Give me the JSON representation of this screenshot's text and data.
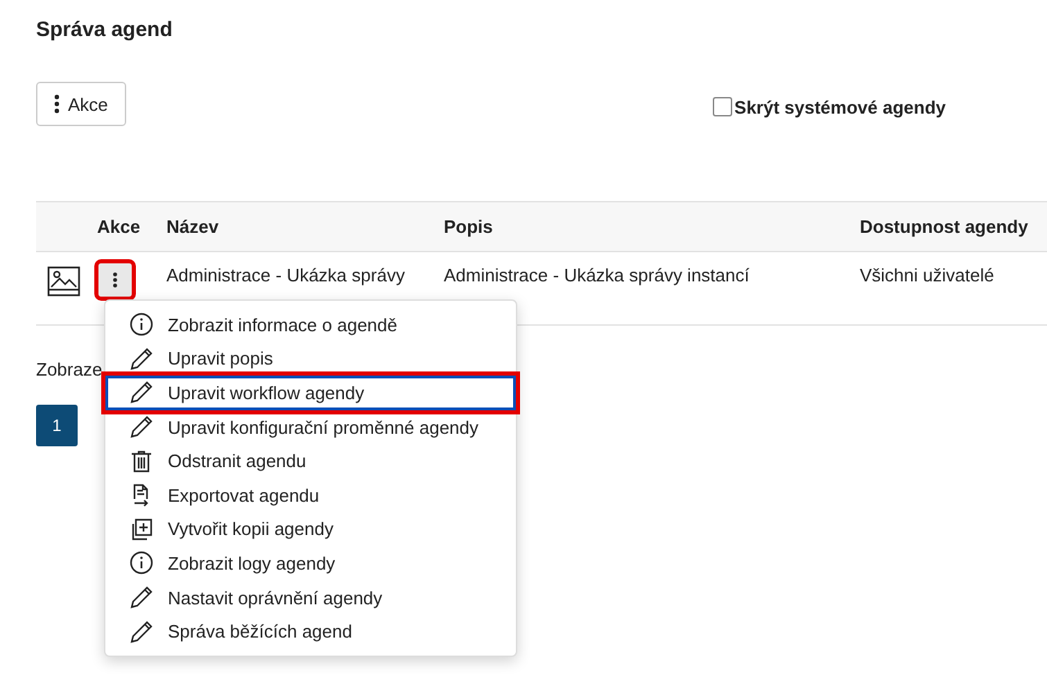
{
  "page": {
    "title": "Správa agend"
  },
  "toolbar": {
    "actions_button": "Akce",
    "hide_system": {
      "label": "Skrýt systémové agendy",
      "checked": false
    }
  },
  "table": {
    "columns": [
      "",
      "Akce",
      "Název",
      "Popis",
      "Dostupnost agendy"
    ],
    "rows": [
      {
        "name": "Administrace - Ukázka správy",
        "description": "Administrace - Ukázka správy instancí",
        "availability": "Všichni uživatelé",
        "actions_highlighted": true
      }
    ]
  },
  "footer_text": "Zobraze",
  "pagination": [
    {
      "label": "1",
      "selected": true
    }
  ],
  "context_menu": {
    "items": [
      {
        "kind": "info",
        "label": "Zobrazit informace o agendě",
        "highlighted": false
      },
      {
        "kind": "edit",
        "label": "Upravit popis",
        "highlighted": false
      },
      {
        "kind": "edit",
        "label": "Upravit workflow agendy",
        "highlighted": true
      },
      {
        "kind": "edit",
        "label": "Upravit konfigurační proměnné agendy",
        "highlighted": false
      },
      {
        "kind": "delete",
        "label": "Odstranit agendu",
        "highlighted": false
      },
      {
        "kind": "export",
        "label": "Exportovat agendu",
        "highlighted": false
      },
      {
        "kind": "copy",
        "label": "Vytvořit kopii agendy",
        "highlighted": false
      },
      {
        "kind": "info",
        "label": "Zobrazit logy agendy",
        "highlighted": false
      },
      {
        "kind": "edit",
        "label": "Nastavit oprávnění agendy",
        "highlighted": false
      },
      {
        "kind": "edit",
        "label": "Správa běžících agend",
        "highlighted": false
      }
    ]
  }
}
